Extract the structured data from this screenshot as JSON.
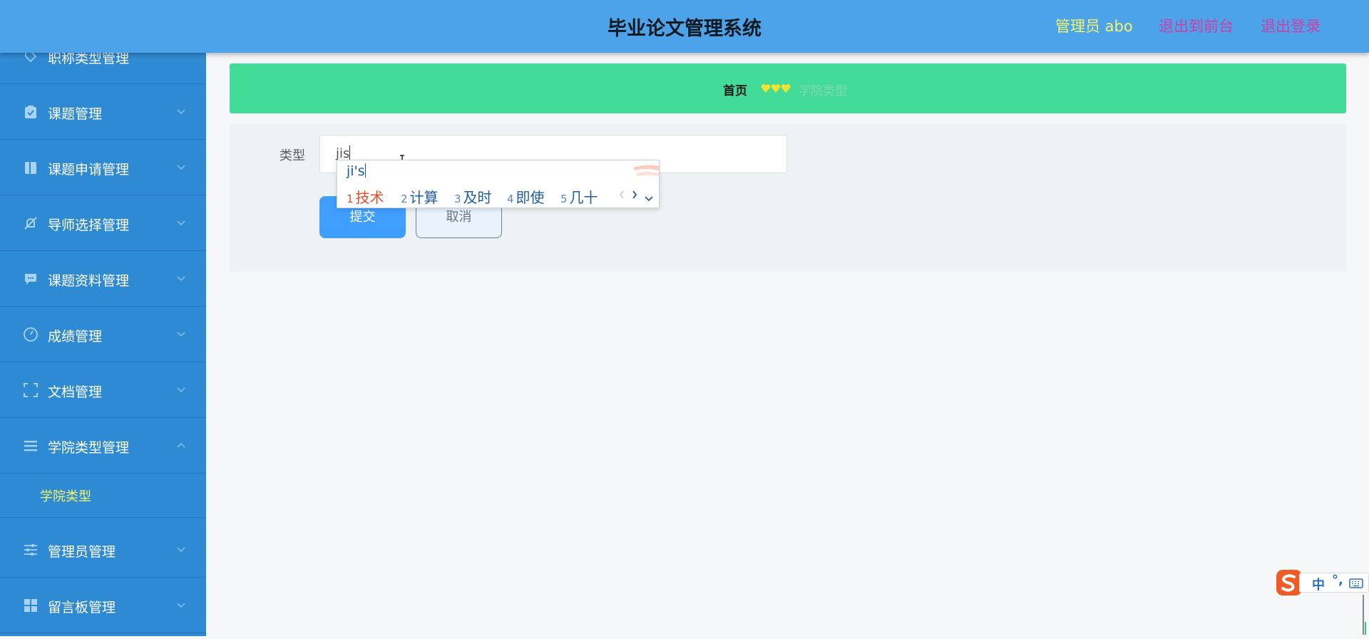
{
  "header": {
    "title": "毕业论文管理系统",
    "admin_label": "管理员 abo",
    "front_link": "退出到前台",
    "logout_link": "退出登录"
  },
  "sidebar": {
    "items": [
      {
        "label": "职称类型管理",
        "icon": "tag-icon"
      },
      {
        "label": "课题管理",
        "icon": "clipboard-icon"
      },
      {
        "label": "课题申请管理",
        "icon": "book-icon"
      },
      {
        "label": "导师选择管理",
        "icon": "bell-off-icon"
      },
      {
        "label": "课题资料管理",
        "icon": "chat-icon"
      },
      {
        "label": "成绩管理",
        "icon": "gauge-icon"
      },
      {
        "label": "文档管理",
        "icon": "frame-icon"
      },
      {
        "label": "学院类型管理",
        "icon": "menu-icon"
      },
      {
        "label": "管理员管理",
        "icon": "sliders-icon"
      },
      {
        "label": "留言板管理",
        "icon": "grid-icon"
      }
    ],
    "active_submenu": "学院类型"
  },
  "breadcrumb": {
    "home": "首页",
    "current": "学院类型"
  },
  "form": {
    "type_label": "类型",
    "type_value": "jis",
    "submit_label": "提交",
    "cancel_label": "取消"
  },
  "ime": {
    "pinyin": "ji's",
    "candidates": [
      {
        "num": "1",
        "text": "技术"
      },
      {
        "num": "2",
        "text": "计算"
      },
      {
        "num": "3",
        "text": "及时"
      },
      {
        "num": "4",
        "text": "即使"
      },
      {
        "num": "5",
        "text": "几十"
      }
    ],
    "status": {
      "mode": "中",
      "punct": "°,"
    }
  },
  "colors": {
    "header": "#4da3ea",
    "sidebar": "#2f8ad4",
    "breadcrumb": "#42dc98",
    "accent_yellow": "#f2f56a",
    "link_pink": "#cc3fa6",
    "button_blue": "#409eff"
  }
}
